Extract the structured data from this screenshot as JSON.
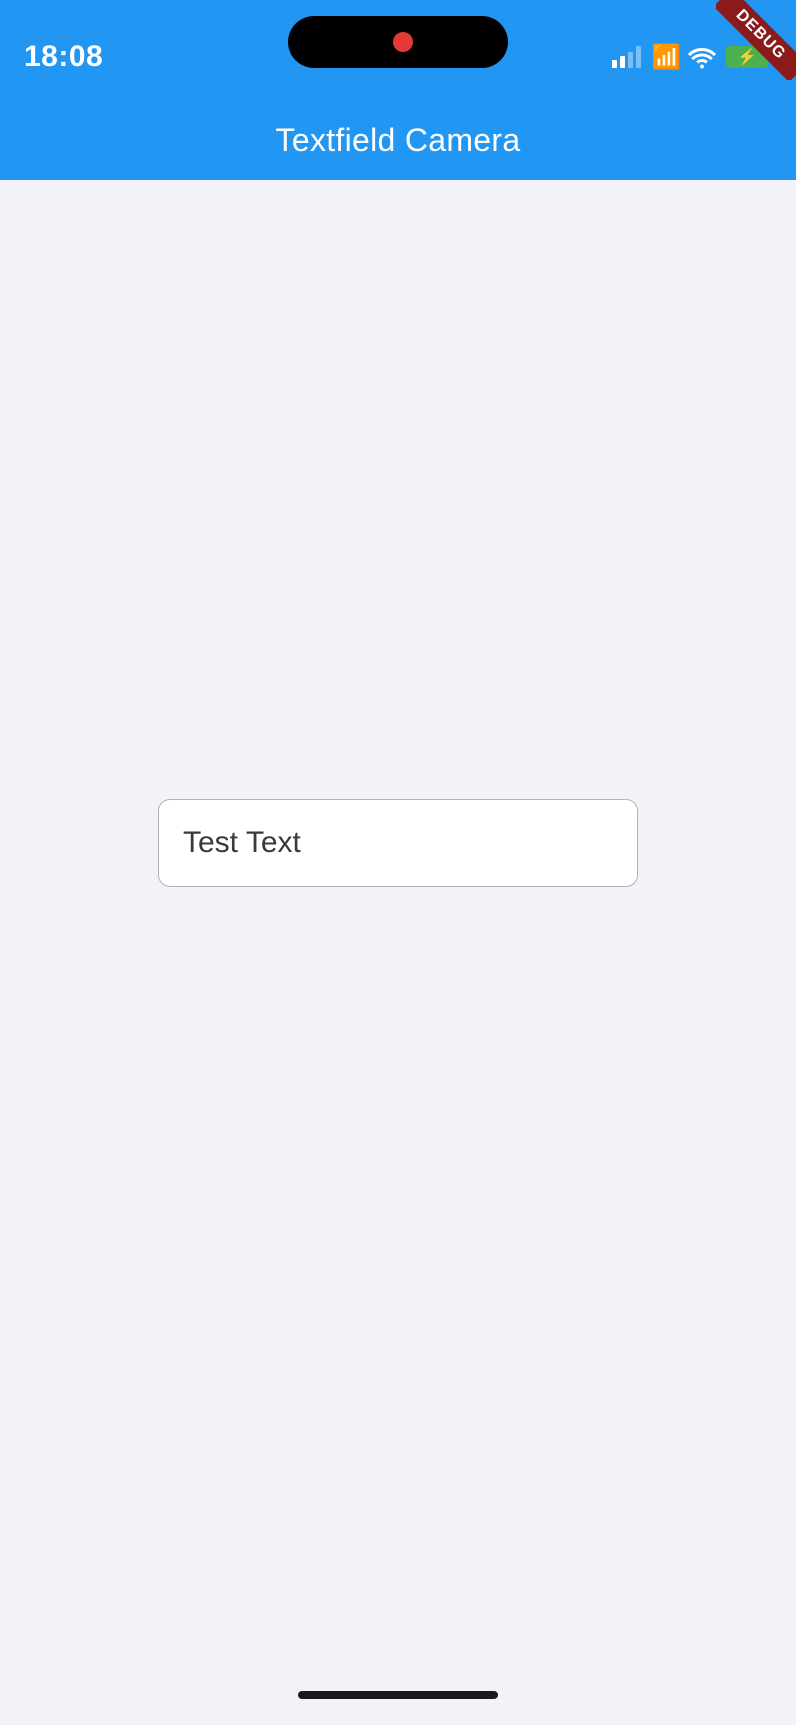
{
  "statusBar": {
    "time": "18:08",
    "dynamicIsland": true
  },
  "debugBanner": {
    "label": "DEBUG"
  },
  "appBar": {
    "title": "Textfield Camera"
  },
  "textField": {
    "value": "Test Text",
    "placeholder": "Test Text"
  },
  "homeIndicator": true
}
